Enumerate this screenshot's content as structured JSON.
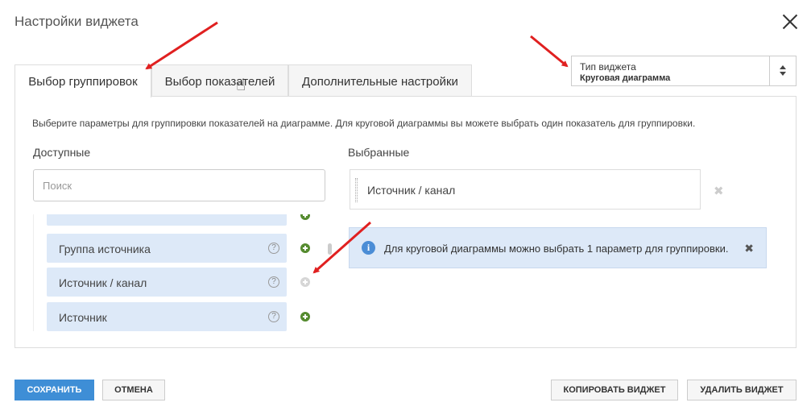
{
  "dialog": {
    "title": "Настройки виджета"
  },
  "widget_type": {
    "label": "Тип виджета",
    "value": "Круговая диаграмма"
  },
  "tabs": [
    {
      "label": "Выбор группировок",
      "active": true
    },
    {
      "label": "Выбор показателей",
      "active": false
    },
    {
      "label": "Дополнительные настройки",
      "active": false
    }
  ],
  "panel": {
    "hint": "Выберите параметры для группировки показателей на диаграмме. Для круговой диаграммы вы можете выбрать один показатель для группировки.",
    "available_title": "Доступные",
    "selected_title": "Выбранные",
    "search_placeholder": "Поиск",
    "available_items": [
      {
        "label": "Группа источника",
        "help": "?",
        "addable": true
      },
      {
        "label": "Источник / канал",
        "help": "?",
        "addable": false
      },
      {
        "label": "Источник",
        "help": "?",
        "addable": true
      }
    ],
    "selected_items": [
      {
        "label": "Источник / канал"
      }
    ],
    "info_icon": "i",
    "info_message": "Для круговой диаграммы можно выбрать 1 параметр для группировки.",
    "info_close": "✖",
    "remove_icon": "✖"
  },
  "footer": {
    "save": "СОХРАНИТЬ",
    "cancel": "ОТМЕНА",
    "copy": "КОПИРОВАТЬ ВИДЖЕТ",
    "delete": "УДАЛИТЬ ВИДЖЕТ"
  },
  "colors": {
    "primary": "#3e8ed6",
    "item_bg": "#dde9f8",
    "add_icon": "#558b2f",
    "annotation_arrow": "#e02020"
  }
}
